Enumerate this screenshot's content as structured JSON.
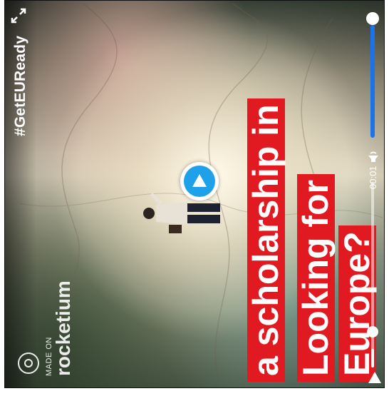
{
  "video": {
    "hashtag": "#GetEUReady",
    "headline_lines": [
      "Looking for",
      "a scholarship in",
      "Europe?"
    ],
    "brand": {
      "made_on": "MADE ON",
      "name": "rocketium"
    },
    "colors": {
      "headline_bg": "#e11a22",
      "play_circle": "#1ea1e9",
      "volume": "#1a73e8"
    }
  },
  "controls": {
    "time": "00:01",
    "progress_fraction": 0.1,
    "volume_fraction": 1.0,
    "icons": {
      "play": "play-icon",
      "volume": "volume-icon",
      "fullscreen": "fullscreen-icon",
      "center_play": "play-circle-icon"
    }
  }
}
